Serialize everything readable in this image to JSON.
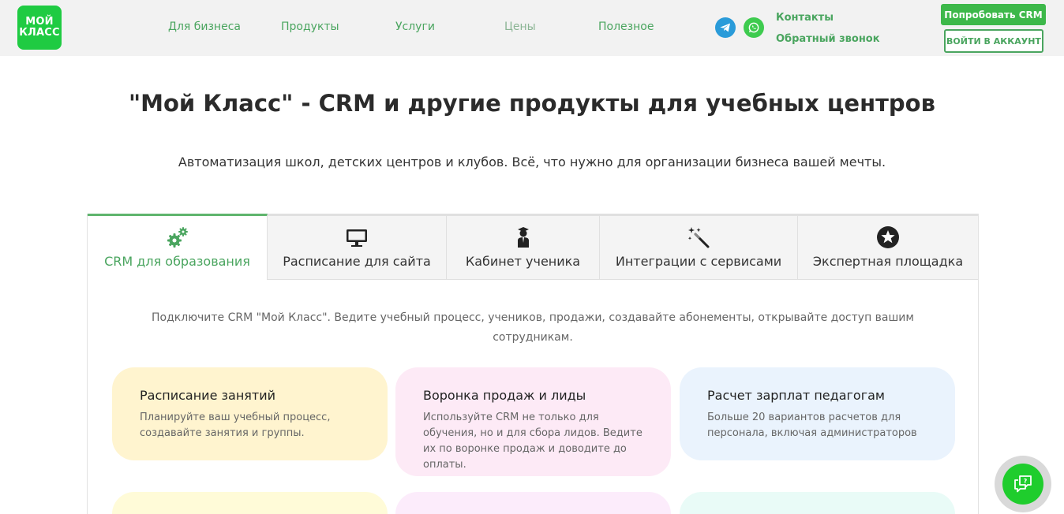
{
  "header": {
    "logo_line1": "МОЙ",
    "logo_line2": "КЛАСС",
    "nav": [
      "Для бизнеса",
      "Продукты",
      "Услуги",
      "Цены",
      "Полезное"
    ],
    "contacts": "Контакты",
    "callback": "Обратный звонок",
    "try_button": "Попробовать CRM",
    "login_button": "ВОЙТИ В АККАУНТ"
  },
  "hero": {
    "title": "\"Мой Класс\" - CRM и другие продукты для учебных центров",
    "subtitle": "Автоматизация школ, детских центров и клубов. Всё, что нужно для организации бизнеса вашей мечты."
  },
  "tabs": [
    {
      "label": "CRM для образования",
      "icon": "gears-icon",
      "active": true
    },
    {
      "label": "Расписание для сайта",
      "icon": "monitor-icon",
      "active": false
    },
    {
      "label": "Кабинет ученика",
      "icon": "student-icon",
      "active": false
    },
    {
      "label": "Интеграции с сервисами",
      "icon": "magic-wand-icon",
      "active": false
    },
    {
      "label": "Экспертная площадка",
      "icon": "star-icon",
      "active": false
    }
  ],
  "tab_content": {
    "description": "Подключите CRM \"Мой Класс\". Ведите учебный процесс, учеников, продажи, создавайте абонементы, открывайте доступ вашим сотрудникам.",
    "cards": [
      {
        "title": "Расписание занятий",
        "text": "Планируйте ваш учебный процесс, создавайте занятия и группы."
      },
      {
        "title": "Воронка продаж и лиды",
        "text": "Используйте CRM не только для обучения, но и для сбора лидов. Ведите их по воронке продаж и доводите до оплаты."
      },
      {
        "title": "Расчет зарплат педагогам",
        "text": "Больше 20 вариантов расчетов для персонала, включая администраторов"
      }
    ]
  },
  "colors": {
    "brand_green": "#1fcb42",
    "link_green": "#4aa55f",
    "card_yellow": "#fff4cf",
    "card_pink": "#fdeaf6",
    "card_blue": "#eaf3fd"
  }
}
